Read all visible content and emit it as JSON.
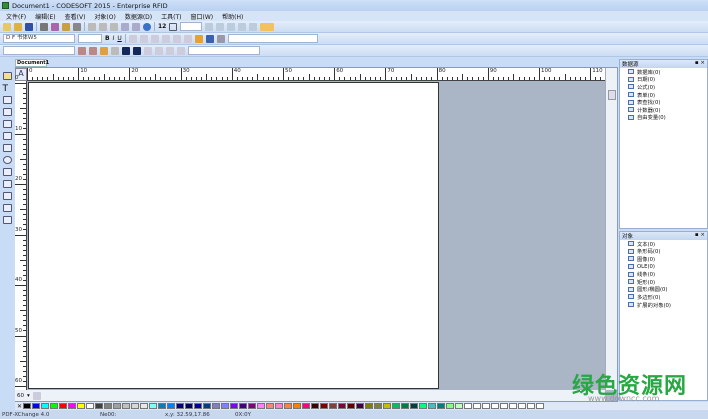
{
  "window": {
    "title": "Document1 - CODESOFT 2015 - Enterprise RFID"
  },
  "menu": [
    "文件(F)",
    "编辑(E)",
    "查看(V)",
    "对象(O)",
    "数据源(D)",
    "工具(T)",
    "窗口(W)",
    "帮助(H)"
  ],
  "toolbar": {
    "zoom_value": "12",
    "font_name": "D F 书体W5"
  },
  "document_tab": "Document1",
  "ruler": {
    "h_labels": [
      "0",
      "10",
      "20",
      "30",
      "40",
      "50",
      "60",
      "70",
      "80",
      "90",
      "100",
      "110"
    ],
    "v_labels": [
      "0",
      "10",
      "20",
      "30",
      "40",
      "50",
      "60"
    ]
  },
  "bottom": {
    "zoom": "60"
  },
  "data_panel": {
    "title": "数据源",
    "items": [
      "数据库(0)",
      "日期(0)",
      "公式(0)",
      "表单(0)",
      "表查找(0)",
      "计数器(0)",
      "自由变量(0)"
    ]
  },
  "objects_panel": {
    "title": "对象",
    "items": [
      "文本(0)",
      "条形码(0)",
      "图像(0)",
      "OLE(0)",
      "线条(0)",
      "矩形(0)",
      "圆形/椭圆(0)",
      "多边形(0)",
      "扩展的对象(0)"
    ]
  },
  "palette": [
    "#000000",
    "#0000ff",
    "#00ffff",
    "#00ff00",
    "#ff0000",
    "#ff00ff",
    "#ffff00",
    "#ffffff",
    "#404040",
    "#808080",
    "#a0a0a0",
    "#c0c0c0",
    "#d8d8d8",
    "#e8e8e8",
    "#80ffff",
    "#0080c0",
    "#0080ff",
    "#000080",
    "#000060",
    "#0000a0",
    "#004080",
    "#8080c0",
    "#8080ff",
    "#8000ff",
    "#400080",
    "#800080",
    "#ff80ff",
    "#ff8080",
    "#ff80c0",
    "#ff8040",
    "#ff8000",
    "#ff0080",
    "#400000",
    "#800000",
    "#804040",
    "#800040",
    "#600000",
    "#400040",
    "#808000",
    "#808040",
    "#c0c000",
    "#00c060",
    "#008040",
    "#004040",
    "#00ff80",
    "#40c0c0",
    "#008080",
    "#80ff80",
    "#c0ffc0",
    "#ffffff",
    "#ffffff",
    "#ffffff",
    "#ffffff",
    "#ffffff",
    "#ffffff",
    "#ffffff",
    "#ffffff",
    "#ffffff"
  ],
  "status": {
    "printer": "PDF-XChange 4.0",
    "port": "Ne00:",
    "coords": "x,y: 32.59,17.86",
    "size": "0X:0Y"
  },
  "watermark": {
    "text": "绿色资源网",
    "url": "www.downcc.com"
  }
}
